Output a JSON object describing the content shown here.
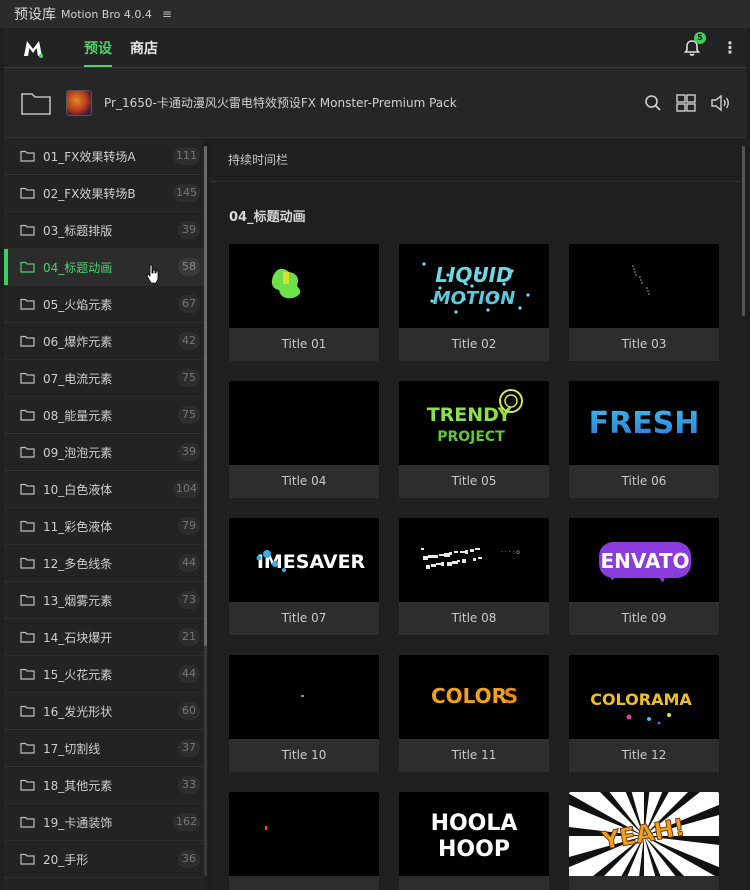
{
  "titlebar": {
    "title": "预设库",
    "app": "Motion Bro 4.0.4",
    "menu_icon": "≡"
  },
  "header": {
    "tabs": [
      {
        "label": "预设",
        "active": true
      },
      {
        "label": "商店",
        "active": false
      }
    ],
    "notification_count": "5",
    "accent": "#4fd16b"
  },
  "pack": {
    "title": "Pr_1650-卡通动漫风火雷电特效预设FX Monster-Premium Pack"
  },
  "sidebar": {
    "categories": [
      {
        "label": "01_FX效果转场A",
        "count": "111"
      },
      {
        "label": "02_FX效果转场B",
        "count": "145"
      },
      {
        "label": "03_标题排版",
        "count": "39"
      },
      {
        "label": "04_标题动画",
        "count": "58"
      },
      {
        "label": "05_火焰元素",
        "count": "67"
      },
      {
        "label": "06_爆炸元素",
        "count": "42"
      },
      {
        "label": "07_电流元素",
        "count": "75"
      },
      {
        "label": "08_能量元素",
        "count": "75"
      },
      {
        "label": "09_泡泡元素",
        "count": "39"
      },
      {
        "label": "10_白色液体",
        "count": "104"
      },
      {
        "label": "11_彩色液体",
        "count": "79"
      },
      {
        "label": "12_多色线条",
        "count": "44"
      },
      {
        "label": "13_烟雾元素",
        "count": "73"
      },
      {
        "label": "14_石块爆开",
        "count": "21"
      },
      {
        "label": "15_火花元素",
        "count": "44"
      },
      {
        "label": "16_发光形状",
        "count": "60"
      },
      {
        "label": "17_切割线",
        "count": "37"
      },
      {
        "label": "18_其他元素",
        "count": "33"
      },
      {
        "label": "19_卡通装饰",
        "count": "162"
      },
      {
        "label": "20_手形",
        "count": "36"
      }
    ]
  },
  "main": {
    "timeline_label": "持续时间栏",
    "section_title": "04_标题动画",
    "items": [
      {
        "label": "Title 01",
        "art": ""
      },
      {
        "label": "Title 02",
        "art": "LIQUID MOTION"
      },
      {
        "label": "Title 03",
        "art": ""
      },
      {
        "label": "Title 04",
        "art": ""
      },
      {
        "label": "Title 05",
        "art": "TRENDY PROJECT"
      },
      {
        "label": "Title 06",
        "art": "FRESH"
      },
      {
        "label": "Title 07",
        "art": "IMESAVER"
      },
      {
        "label": "Title 08",
        "art": ""
      },
      {
        "label": "Title 09",
        "art": "ENVATO"
      },
      {
        "label": "Title 10",
        "art": ""
      },
      {
        "label": "Title 11",
        "art": "COLORS"
      },
      {
        "label": "Title 12",
        "art": "COLORAMA"
      },
      {
        "label": "",
        "art": ""
      },
      {
        "label": "",
        "art": "HOOLA HOOP"
      },
      {
        "label": "",
        "art": "YEAH!"
      }
    ]
  }
}
